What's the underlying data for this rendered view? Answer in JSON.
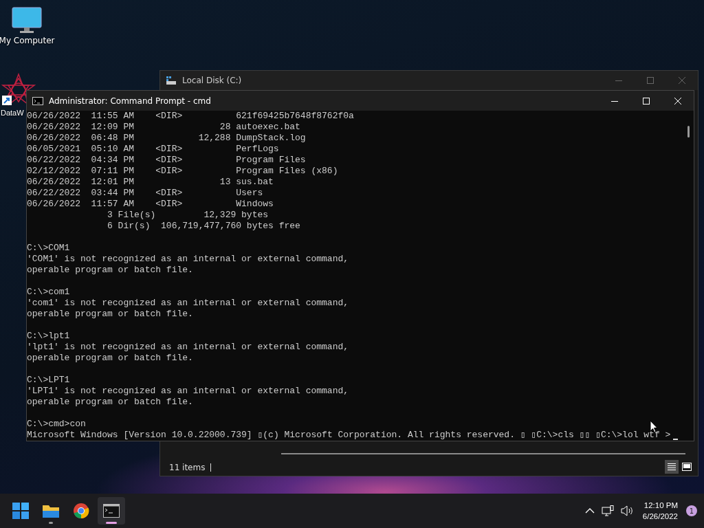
{
  "desktop_icons": [
    {
      "kind": "monitor",
      "label": "My Computer"
    },
    {
      "kind": "shortcut",
      "label": "DataW"
    }
  ],
  "explorer_window": {
    "title": "Local Disk (C:)",
    "status": "11 items"
  },
  "cmd_window": {
    "title": "Administrator: Command Prompt - cmd",
    "blocks": [
      [
        "06/26/2022  11:55 AM    <DIR>          621f69425b7648f8762f0a",
        "06/26/2022  12:09 PM                28 autoexec.bat",
        "06/26/2022  06:48 PM            12,288 DumpStack.log",
        "06/05/2021  05:10 AM    <DIR>          PerfLogs",
        "06/22/2022  04:34 PM    <DIR>          Program Files",
        "02/12/2022  07:11 PM    <DIR>          Program Files (x86)",
        "06/26/2022  12:01 PM                13 sus.bat",
        "06/22/2022  03:44 PM    <DIR>          Users",
        "06/26/2022  11:57 AM    <DIR>          Windows",
        "               3 File(s)         12,329 bytes",
        "               6 Dir(s)  106,719,477,760 bytes free"
      ],
      [
        "C:\\>COM1",
        "'COM1' is not recognized as an internal or external command,",
        "operable program or batch file."
      ],
      [
        "C:\\>com1",
        "'com1' is not recognized as an internal or external command,",
        "operable program or batch file."
      ],
      [
        "C:\\>lpt1",
        "'lpt1' is not recognized as an internal or external command,",
        "operable program or batch file."
      ],
      [
        "C:\\>LPT1",
        "'LPT1' is not recognized as an internal or external command,",
        "operable program or batch file."
      ],
      [
        "C:\\>cmd>con",
        "Microsoft Windows [Version 10.0.22000.739] ▯(c) Microsoft Corporation. All rights reserved. ▯ ▯C:\\>cls ▯▯ ▯C:\\>lol wtf >"
      ]
    ]
  },
  "taskbar": {
    "apps": [
      {
        "kind": "start",
        "running": false,
        "active": false
      },
      {
        "kind": "explorer",
        "running": true,
        "active": false
      },
      {
        "kind": "chrome",
        "running": false,
        "active": false
      },
      {
        "kind": "terminal",
        "running": true,
        "active": true
      }
    ],
    "time": "12:10 PM",
    "date": "6/26/2022",
    "notifications": "1"
  }
}
